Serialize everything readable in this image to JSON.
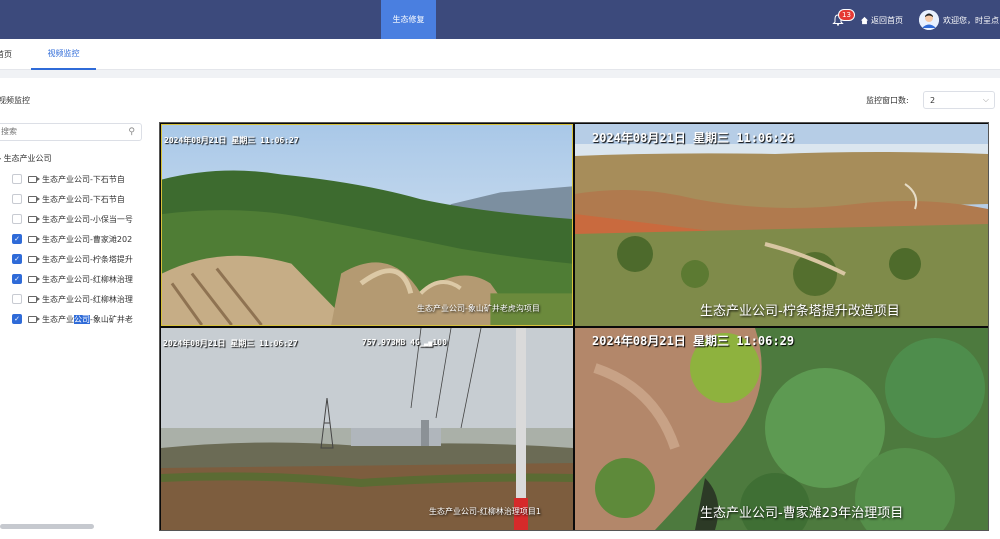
{
  "header": {
    "active_nav": "生态修复",
    "notification_count": "13",
    "home_link": "返回首页",
    "welcome": "欢迎您，时呈点"
  },
  "tabs": [
    {
      "label": "首页"
    },
    {
      "label": "视频监控"
    }
  ],
  "page": {
    "title": "视频监控",
    "window_count_label": "监控窗口数:",
    "window_count_value": "2"
  },
  "tree": {
    "search_placeholder": "搜索",
    "root": "生态产业公司",
    "items": [
      {
        "label": "生态产业公司-下石节自",
        "checked": false
      },
      {
        "label": "生态产业公司-下石节自",
        "checked": false
      },
      {
        "label": "生态产业公司-小保当一号",
        "checked": false
      },
      {
        "label": "生态产业公司-曹家滩202",
        "checked": true
      },
      {
        "label": "生态产业公司-柠条塔提升",
        "checked": true
      },
      {
        "label": "生态产业公司-红柳林治理",
        "checked": true
      },
      {
        "label": "生态产业公司-红柳林治理",
        "checked": false
      },
      {
        "label_prefix": "生态产业",
        "label_highlight": "公司",
        "label_suffix": "-象山矿井老",
        "checked": true
      }
    ]
  },
  "videos": [
    {
      "timestamp": "2024年08月21日 星期三 11:06:27",
      "caption": "生态产业公司-象山矿井老虎沟项目"
    },
    {
      "timestamp": "2024年08月21日 星期三 11:06:26",
      "caption": "生态产业公司-柠条塔提升改造项目"
    },
    {
      "timestamp": "2024年08月21日 星期三 11:06:27",
      "extra": "757.973MB  4G",
      "extra2": "100",
      "caption": "生态产业公司-红柳林治理项目1"
    },
    {
      "timestamp": "2024年08月21日 星期三 11:06:29",
      "caption": "生态产业公司-曹家滩23年治理项目"
    }
  ],
  "colors": {
    "header_bg": "#3c4a7c",
    "accent": "#2f6bd8",
    "badge": "#e53935"
  }
}
